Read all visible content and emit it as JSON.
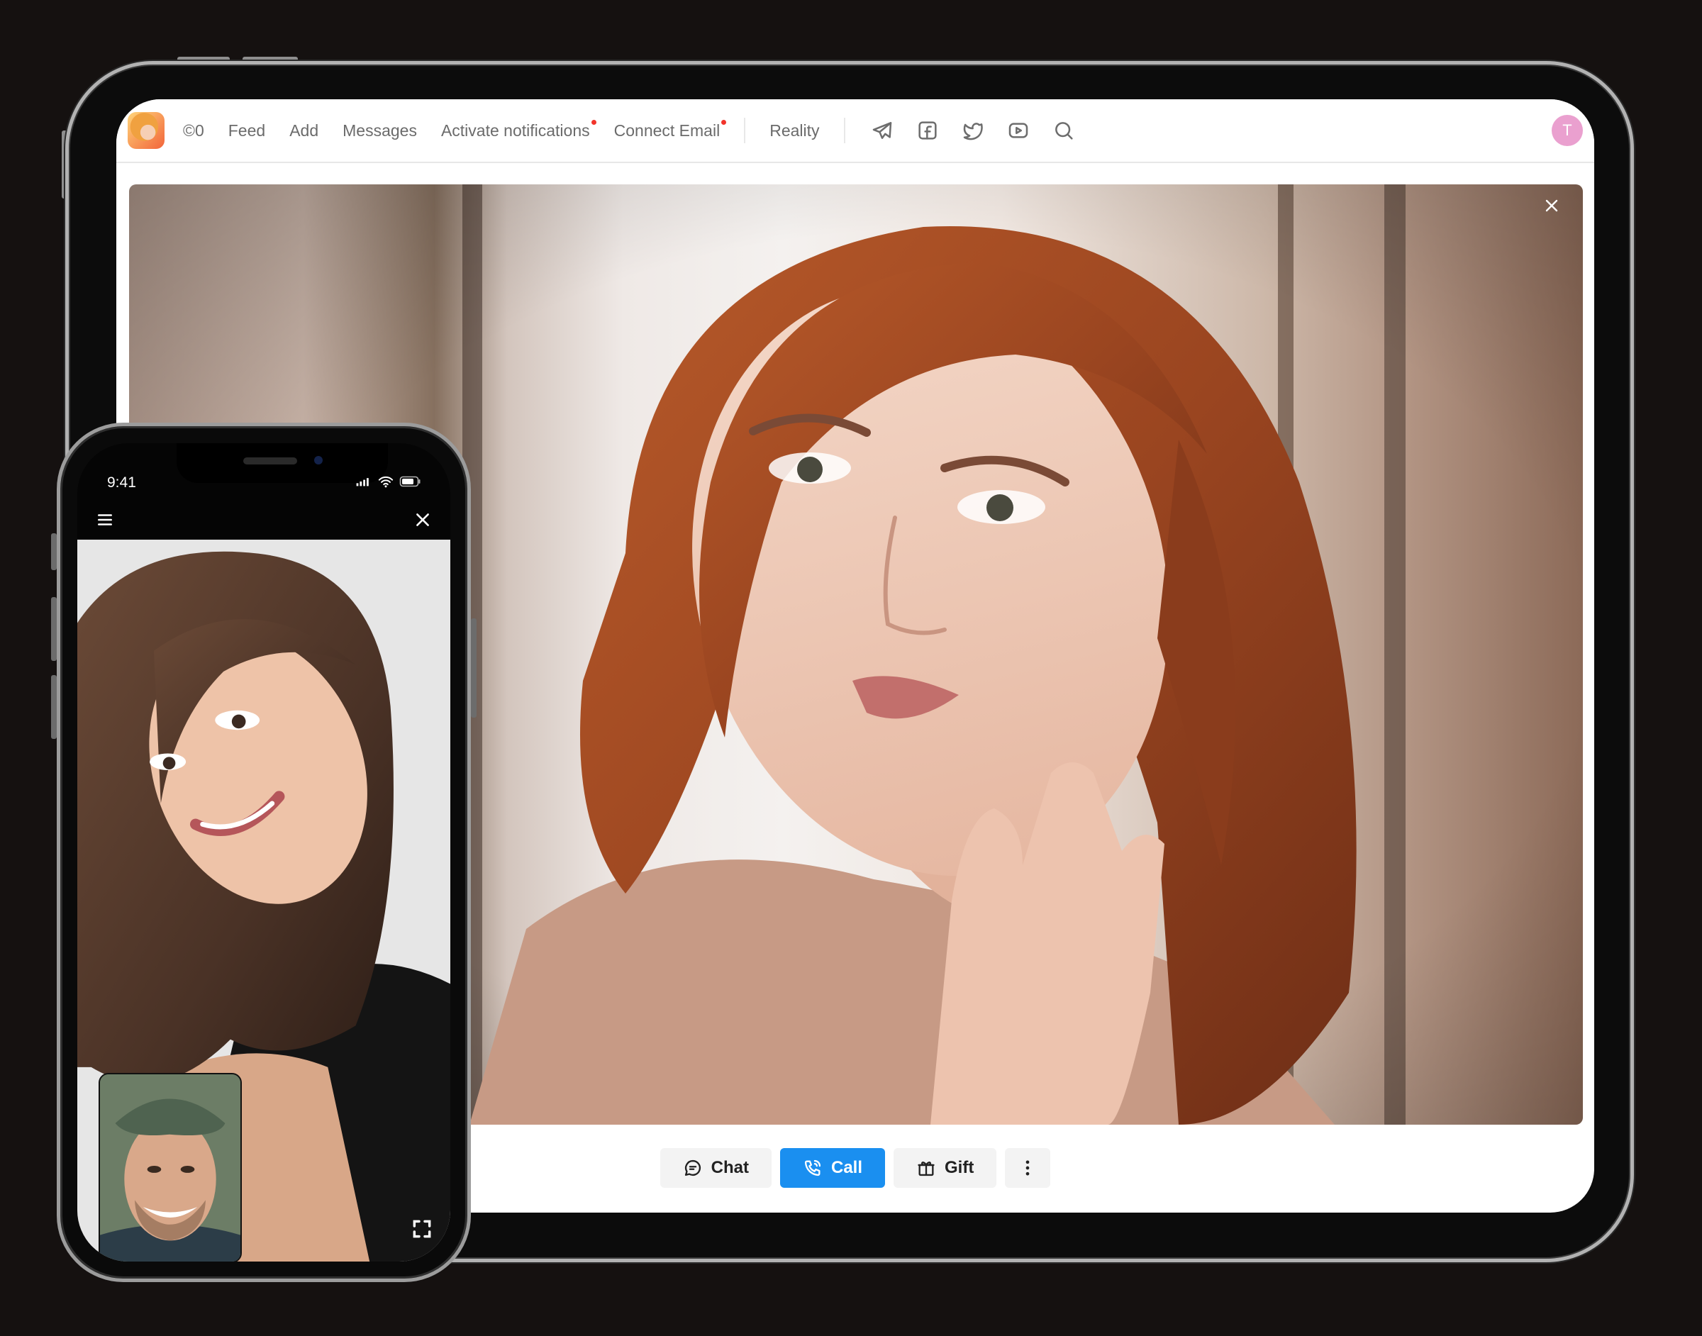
{
  "header": {
    "credits": "©0",
    "nav": [
      {
        "label": "Feed"
      },
      {
        "label": "Add"
      },
      {
        "label": "Messages"
      },
      {
        "label": "Activate notifications"
      },
      {
        "label": "Connect Email"
      },
      {
        "label": "Reality"
      }
    ],
    "social_icons": [
      "telegram-icon",
      "facebook-icon",
      "twitter-icon",
      "youtube-icon"
    ],
    "search_icon": "search-icon",
    "user_initial": "T",
    "notification_dot_color": "#f2342b",
    "avatar_color": "#eaa0cf"
  },
  "actions": {
    "chat_label": "Chat",
    "call_label": "Call",
    "gift_label": "Gift",
    "accent_color": "#1a8ff0"
  },
  "phone": {
    "time": "9:41",
    "menu_icon": "hamburger-icon",
    "close_icon": "close-icon",
    "fullscreen_icon": "fullscreen-icon"
  }
}
